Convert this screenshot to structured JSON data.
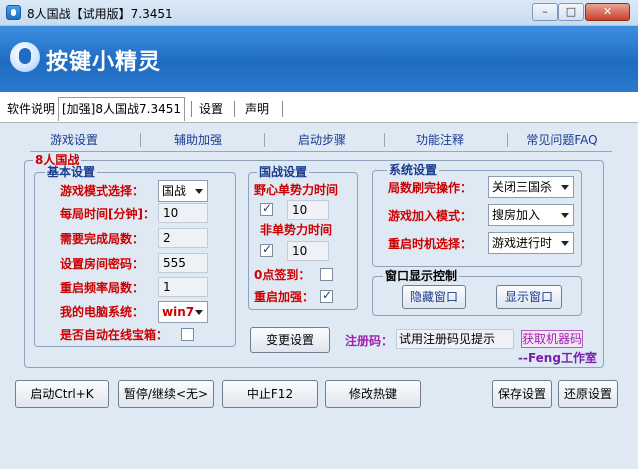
{
  "window": {
    "title": "8人国战【试用版】7.3451",
    "min_label": "–",
    "max_label": "□",
    "close_label": "✕"
  },
  "banner": {
    "title": "按键小精灵"
  },
  "menu": {
    "items": [
      "软件说明",
      "[加强]8人国战7.3451",
      "设置",
      "声明"
    ]
  },
  "tabs": [
    "游戏设置",
    "辅助加强",
    "启动步骤",
    "功能注释",
    "常见问题FAQ"
  ],
  "group_outer": {
    "title": "8人国战"
  },
  "basic": {
    "title": "基本设置",
    "mode_label": "游戏模式选择：",
    "mode_value": "国战",
    "time_label": "每局时间[分钟]：",
    "time_value": "10",
    "rounds_label": "需要完成局数：",
    "rounds_value": "2",
    "pwd_label": "设置房间密码：",
    "pwd_value": "555",
    "restart_label": "重启频率局数：",
    "restart_value": "1",
    "os_label": "我的电脑系统：",
    "os_value": "win7",
    "treasure_label": "是否自动在线宝箱："
  },
  "war": {
    "title": "国战设置",
    "wild_label": "野心单势力时间",
    "wild_value": "10",
    "nonwild_label": "非单势力时间",
    "nonwild_value": "10",
    "signin_label": "0点签到：",
    "restart_label": "重启加强："
  },
  "system": {
    "title": "系统设置",
    "finish_label": "局数刷完操作：",
    "finish_value": "关闭三国杀",
    "join_label": "游戏加入模式：",
    "join_value": "搜房加入",
    "restart_label": "重启时机选择：",
    "restart_value": "游戏进行时"
  },
  "window_ctrl": {
    "title": "窗口显示控制",
    "hide": "隐藏窗口",
    "show": "显示窗口"
  },
  "change_settings": "变更设置",
  "register": {
    "label": "注册码：",
    "value": "试用注册码见提示",
    "get_button": "获取机器码",
    "studio": "--Feng工作室"
  },
  "bottom": {
    "start": "启动Ctrl+K",
    "pause": "暂停/继续<无>",
    "stop": "中止F12",
    "hotkey": "修改热键",
    "save": "保存设置",
    "restore": "还原设置"
  }
}
